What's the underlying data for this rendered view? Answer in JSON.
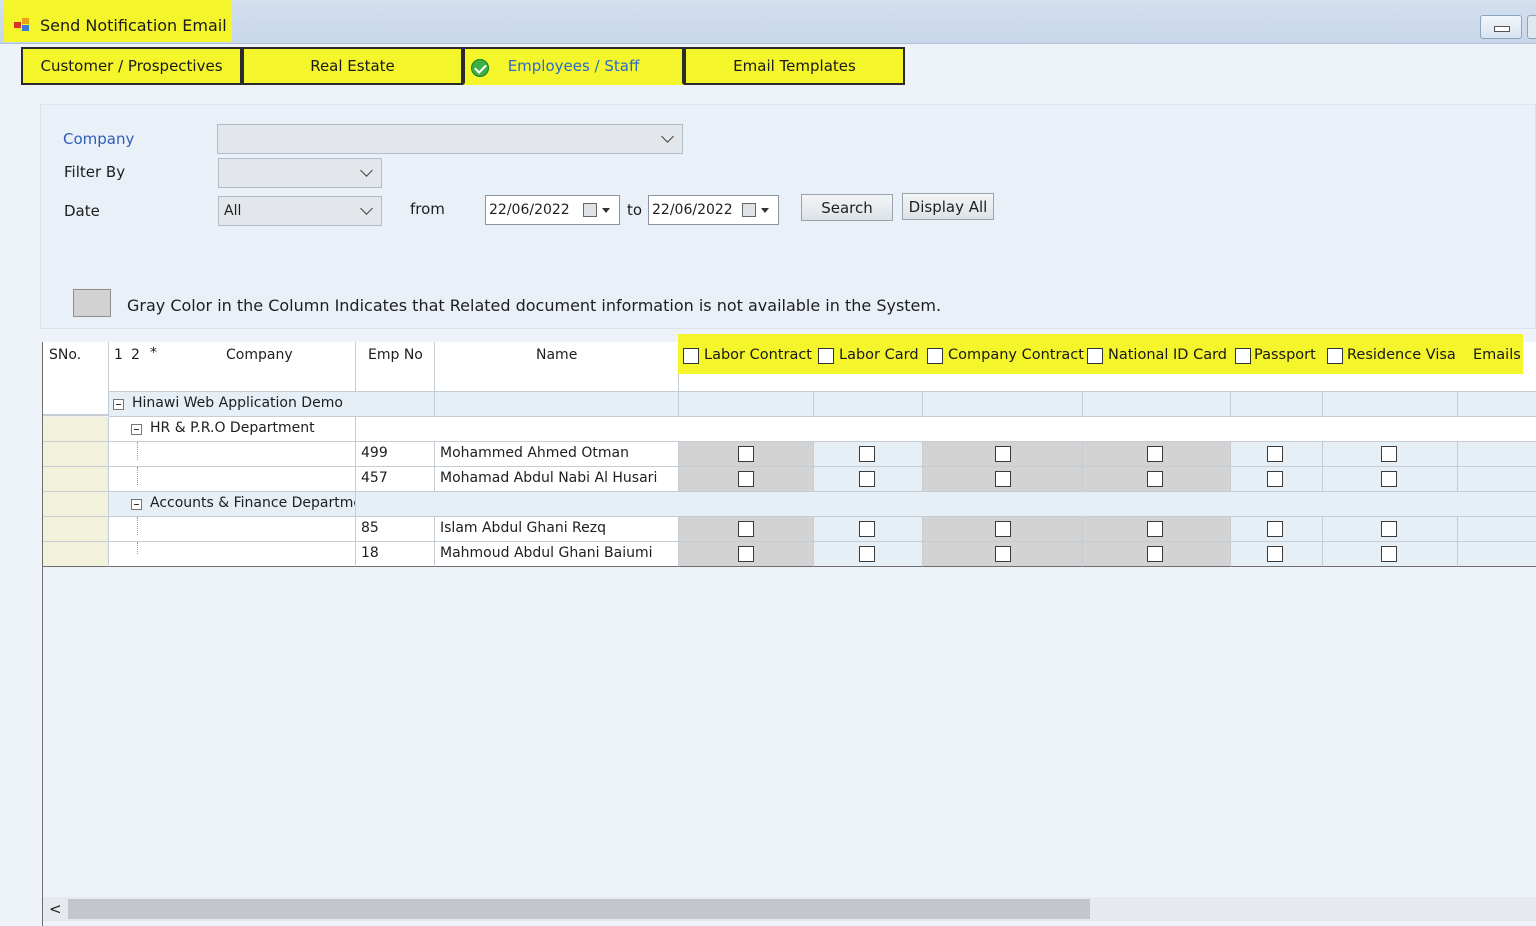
{
  "window": {
    "title": "Send Notification Email"
  },
  "tabs": [
    {
      "label": "Customer / Prospectives",
      "active": false
    },
    {
      "label": "Real Estate",
      "active": false
    },
    {
      "label": "Employees / Staff",
      "active": true
    },
    {
      "label": "Email Templates",
      "active": false
    }
  ],
  "filters": {
    "company_label": "Company",
    "company_value": "",
    "filter_by_label": "Filter By",
    "filter_by_value": "",
    "date_label": "Date",
    "date_value": "All",
    "from_label": "from",
    "from_date": "22/06/2022",
    "to_label": "to",
    "to_date": "22/06/2022",
    "search_label": "Search",
    "display_all_label": "Display All"
  },
  "legend": {
    "text": "Gray Color in the Column Indicates that Related document information is not available in the System.",
    "color": "#d2d2d2"
  },
  "grid": {
    "headers": {
      "sno": "SNo.",
      "group_levels": [
        "1",
        "2",
        "*"
      ],
      "company": "Company",
      "emp_no": "Emp No",
      "name": "Name",
      "labor_contract": "Labor Contract",
      "labor_card": "Labor Card",
      "company_contract": "Company Contract",
      "national_id": "National ID Card",
      "passport": "Passport",
      "residence_visa": "Residence Visa",
      "emails": "Emails"
    },
    "groups": {
      "company": "Hinawi Web Application Demo",
      "dept1": "HR & P.R.O Department",
      "dept2": "Accounts & Finance Department"
    },
    "rows": [
      {
        "emp_no": "499",
        "name": "Mohammed Ahmed Otman"
      },
      {
        "emp_no": "457",
        "name": "Mohamad Abdul Nabi Al Husari"
      },
      {
        "emp_no": "85",
        "name": "Islam Abdul Ghani Rezq"
      },
      {
        "emp_no": "18",
        "name": "Mahmoud Abdul Ghani Baiumi"
      }
    ],
    "highlight_color": "#f4f52a"
  },
  "scrollbar": {
    "left_arrow": "<"
  }
}
